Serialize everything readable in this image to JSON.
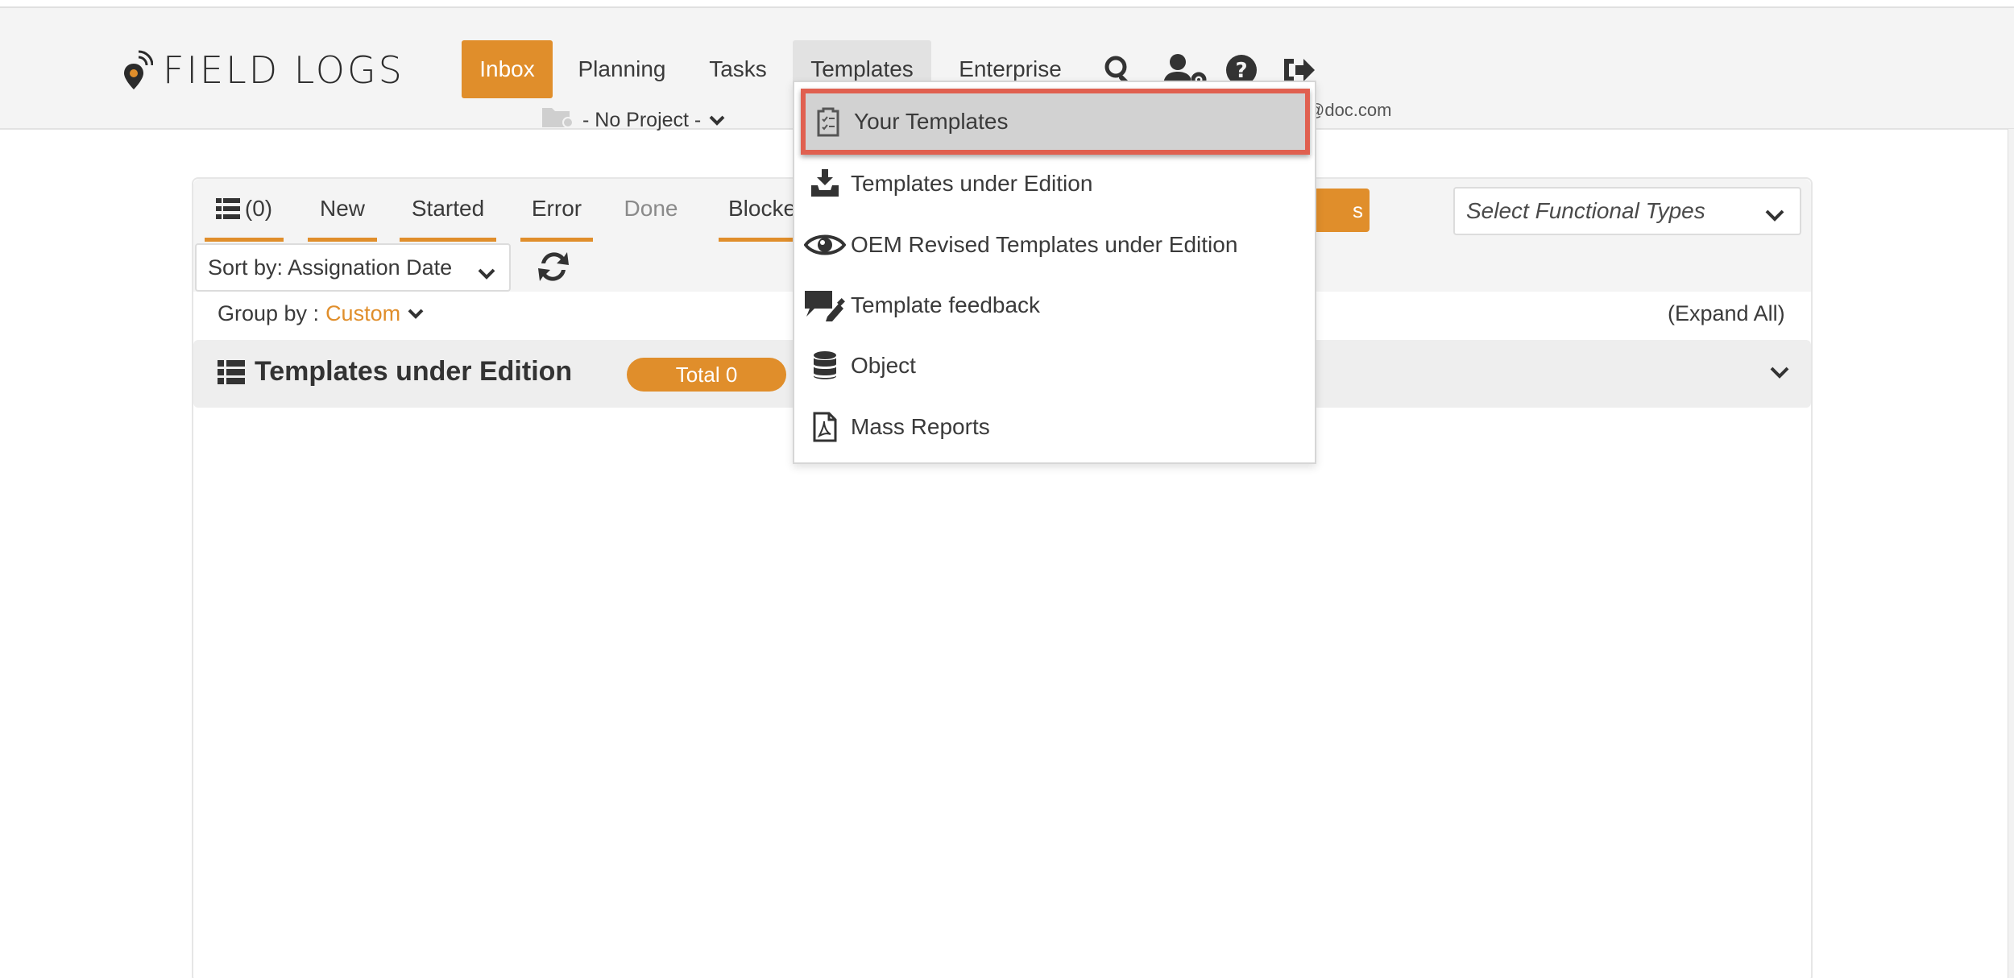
{
  "app": {
    "brand": "FIELD LOGS"
  },
  "nav": {
    "inbox": "Inbox",
    "planning": "Planning",
    "tasks": "Tasks",
    "templates": "Templates",
    "enterprise": "Enterprise"
  },
  "header": {
    "project_label": "- No Project -",
    "user_email_fragment": "@doc.com"
  },
  "filters": {
    "tabs": {
      "all_count": "(0)",
      "new": "New",
      "started": "Started",
      "error": "Error",
      "done": "Done",
      "blocked": "Blocke"
    },
    "hidden_button_fragment": "s",
    "functional_types_placeholder": "Select Functional Types",
    "sort_label": "Sort by: Assignation Date",
    "group_by_label": "Group by :",
    "group_by_value": "Custom",
    "expand_all": "(Expand All)"
  },
  "group": {
    "title": "Templates under Edition",
    "total": "Total 0"
  },
  "templates_menu": {
    "items": [
      {
        "label": "Your Templates",
        "icon": "clipboard-check-icon",
        "active": true
      },
      {
        "label": "Templates under Edition",
        "icon": "inbox-download-icon"
      },
      {
        "label": "OEM Revised Templates under Edition",
        "icon": "eye-icon"
      },
      {
        "label": "Template feedback",
        "icon": "comment-edit-icon"
      },
      {
        "label": "Object",
        "icon": "database-icon"
      },
      {
        "label": "Mass Reports",
        "icon": "file-pdf-icon"
      }
    ]
  },
  "colors": {
    "accent": "#e08e2b",
    "highlight_border": "#e06050"
  }
}
